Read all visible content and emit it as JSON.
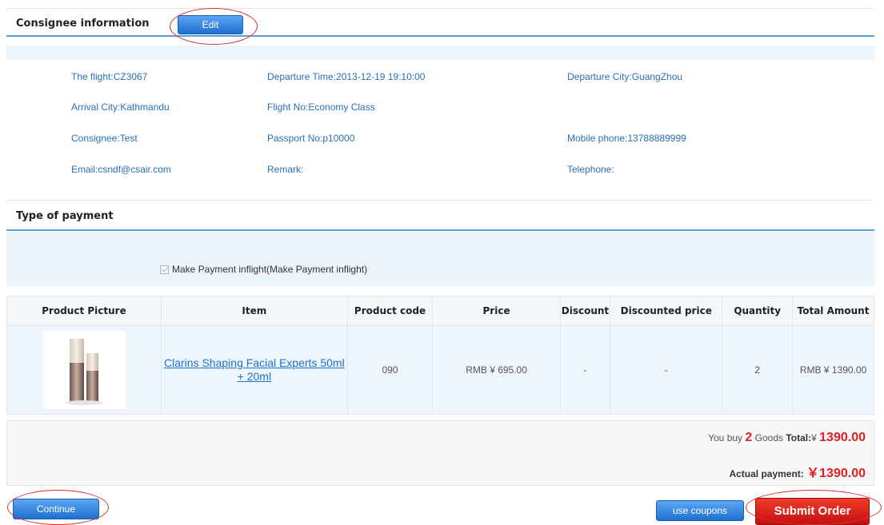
{
  "consignee": {
    "title": "Consignee information",
    "edit_label": "Edit",
    "fields": [
      {
        "text": "The flight:CZ3067"
      },
      {
        "text": "Departure Time:2013-12-19 19:10:00"
      },
      {
        "text": "Departure City:GuangZhou"
      },
      {
        "text": "Arrival City:Kathmandu"
      },
      {
        "text": "Flight No:Economy Class"
      },
      {
        "text": "Consignee:Test"
      },
      {
        "text": "Passport No:p10000"
      },
      {
        "text": "Mobile phone:13788889999"
      },
      {
        "text": "Email:csndf@csair.com"
      },
      {
        "text": "Remark:"
      },
      {
        "text": "Telephone:"
      }
    ]
  },
  "payment": {
    "title": "Type of payment",
    "option_label": "Make Payment inflight(Make Payment inflight)",
    "option_checked": true
  },
  "products": {
    "headers": [
      "Product Picture",
      "Item",
      "Product code",
      "Price",
      "Discount",
      "Discounted price",
      "Quantity",
      "Total Amount"
    ],
    "rows": [
      {
        "picture": "clarins-bottles-image",
        "item": "Clarins Shaping Facial Experts 50ml + 20ml",
        "code": "090",
        "price": "RMB ¥ 695.00",
        "discount": "-",
        "discounted_price": "-",
        "quantity": "2",
        "total": "RMB ¥ 1390.00"
      }
    ]
  },
  "summary": {
    "you_buy_prefix": "You buy",
    "goods_count": "2",
    "goods_label": "Goods",
    "total_label": "Total:",
    "total_currency": "¥",
    "total_value": "1390.00",
    "actual_label": "Actual payment:",
    "actual_currency": "￥",
    "actual_value": "1390.00"
  },
  "actions": {
    "continue_label": "Continue",
    "coupons_label": "use coupons",
    "submit_label": "Submit Order"
  },
  "colors": {
    "accent_blue": "#1e6fd0",
    "link_blue": "#2a6fb5",
    "total_red": "#e02020",
    "annotation_red": "#d93030"
  }
}
